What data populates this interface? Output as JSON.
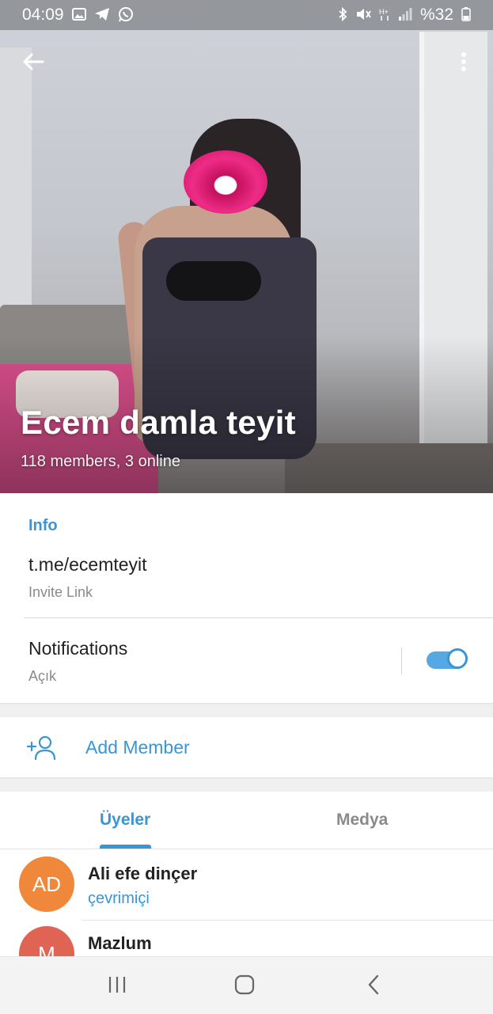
{
  "status_bar": {
    "time": "04:09",
    "battery": "%32",
    "left_icons": [
      "gallery-icon",
      "telegram-icon",
      "whatsapp-icon"
    ],
    "right_icons": [
      "bluetooth-icon",
      "mute-icon",
      "hplus-data-icon",
      "signal-icon",
      "battery-icon"
    ]
  },
  "header": {
    "title": "Ecem damla teyit",
    "subtitle": "118 members, 3 online"
  },
  "info": {
    "heading": "Info",
    "link": "t.me/ecemteyit",
    "link_caption": "Invite Link",
    "notifications_label": "Notifications",
    "notifications_status": "Açık",
    "notifications_on": true
  },
  "add_member": {
    "label": "Add Member"
  },
  "tabs": [
    {
      "label": "Üyeler",
      "active": true
    },
    {
      "label": "Medya",
      "active": false
    }
  ],
  "members": [
    {
      "initials": "AD",
      "name": "Ali efe dinçer",
      "status": "çevrimiçi",
      "avatar_color": "#f0883c"
    },
    {
      "initials": "M",
      "name": "Mazlum",
      "status": "",
      "avatar_color": "#e06454"
    }
  ],
  "colors": {
    "accent": "#3a95d5",
    "toggle_track": "#56a8e3"
  }
}
